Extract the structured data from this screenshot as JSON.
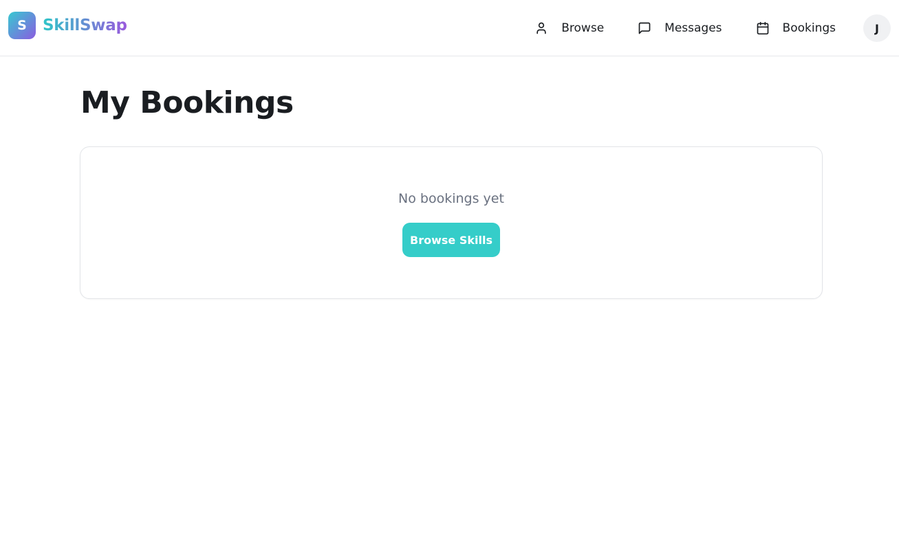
{
  "brand": {
    "logo_letter": "S",
    "name": "SkillSwap"
  },
  "nav": {
    "items": [
      {
        "label": "Browse",
        "icon": "user-icon"
      },
      {
        "label": "Messages",
        "icon": "message-square-icon"
      },
      {
        "label": "Bookings",
        "icon": "calendar-icon"
      }
    ],
    "avatar_initial": "J"
  },
  "page": {
    "title": "My Bookings"
  },
  "empty_state": {
    "message": "No bookings yet",
    "button_label": "Browse Skills"
  },
  "colors": {
    "accent": "#35cdc9",
    "brand_gradient_start": "#37c9d1",
    "brand_gradient_end": "#8a5ce0",
    "text_primary": "#1a1d21",
    "text_muted": "#6a7180",
    "border": "#e2e4e8"
  }
}
